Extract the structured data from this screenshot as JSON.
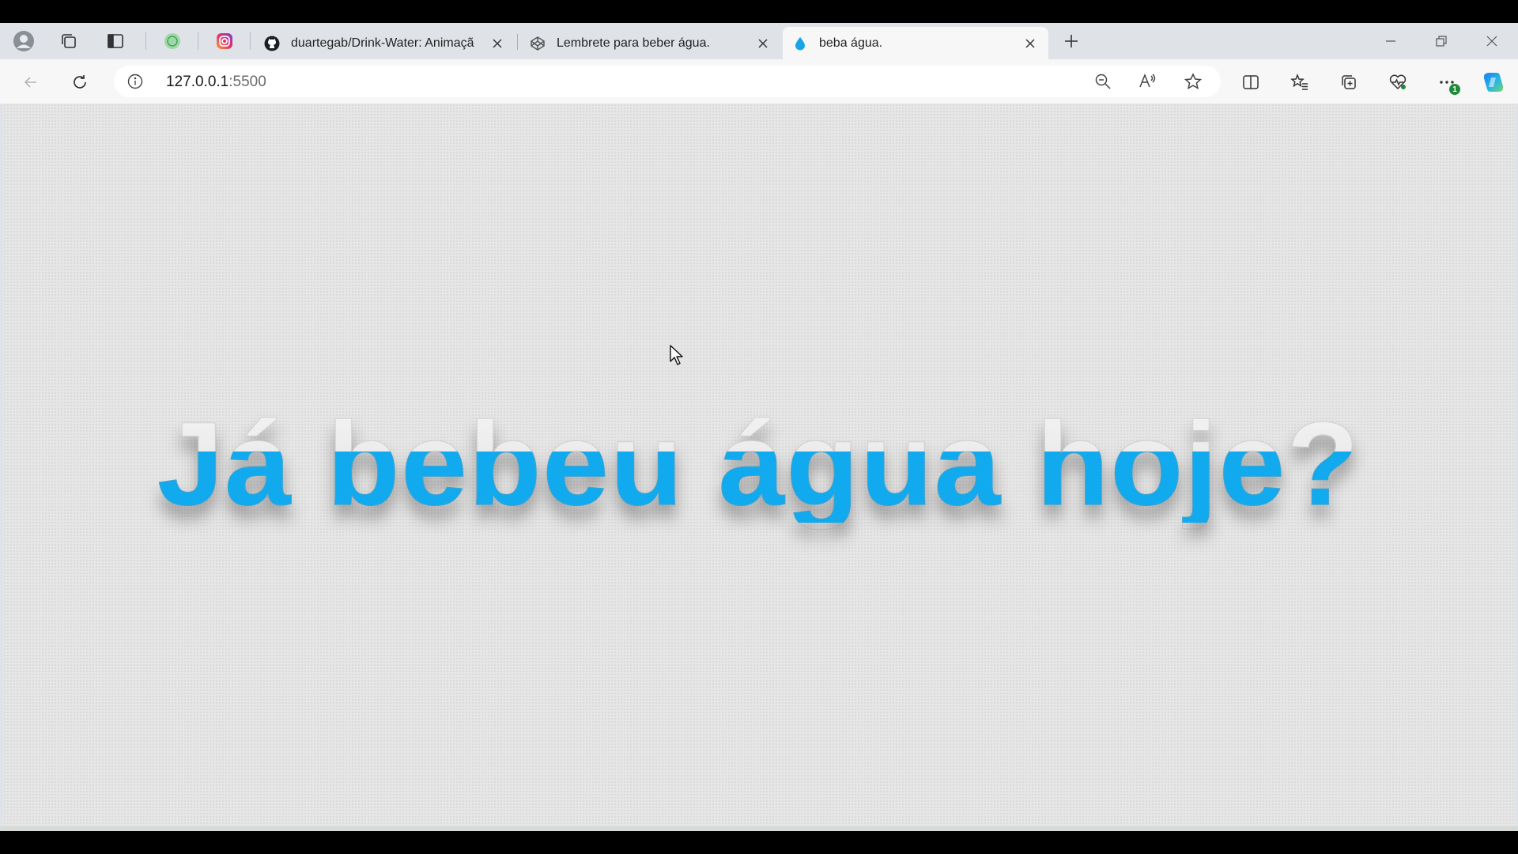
{
  "tabs": [
    {
      "title": "duartegab/Drink-Water: Animaçã",
      "favicon": "github-icon",
      "active": false
    },
    {
      "title": "Lembrete para beber água.",
      "favicon": "codepen-icon",
      "active": false
    },
    {
      "title": "beba água.",
      "favicon": "water-drop-icon",
      "active": true
    }
  ],
  "address_bar": {
    "host": "127.0.0.1",
    "port": ":5500"
  },
  "notification_badge": "1",
  "page": {
    "headline": "Já bebeu água hoje?",
    "fill_level": 0.6
  },
  "colors": {
    "water": "#11aaee",
    "page_bg": "#e6e6e6",
    "active_tab": "#f7f7f7",
    "strip": "#dfe3e8"
  }
}
